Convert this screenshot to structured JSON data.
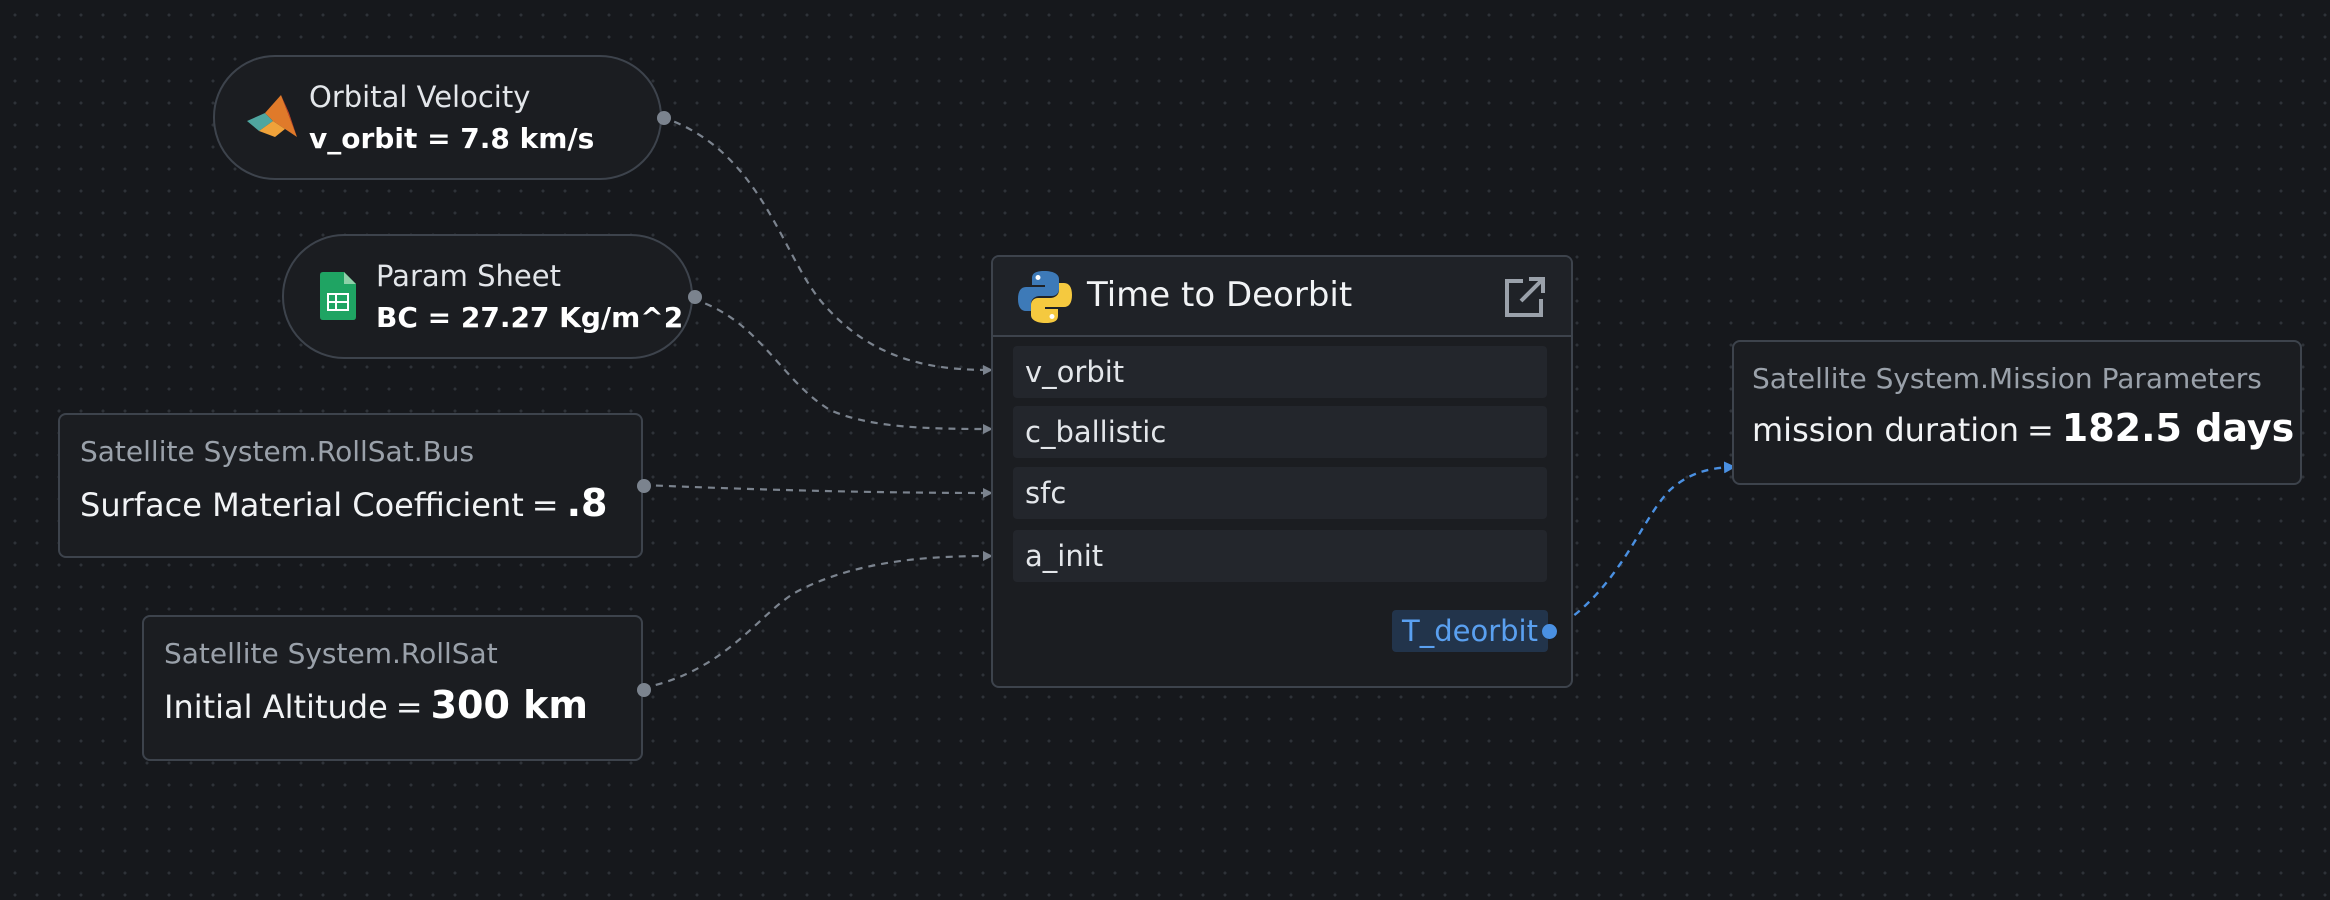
{
  "nodes": {
    "orbital_velocity": {
      "title": "Orbital Velocity",
      "value": "v_orbit = 7.8 km/s",
      "icon": "matlab-icon"
    },
    "param_sheet": {
      "title": "Param Sheet",
      "value": "BC = 27.27 Kg/m^2",
      "icon": "google-sheets-icon"
    },
    "bus_param": {
      "path": "Satellite System.RollSat.Bus",
      "name": "Surface Material Coefficient",
      "equals": "=",
      "value": ".8"
    },
    "altitude_param": {
      "path": "Satellite System.RollSat",
      "name": "Initial Altitude",
      "equals": "=",
      "value": "300 km"
    },
    "mission_param": {
      "path": "Satellite System.Mission Parameters",
      "name": "mission duration",
      "equals": "=",
      "value": "182.5 days"
    }
  },
  "function_node": {
    "title": "Time to Deorbit",
    "icon": "python-icon",
    "action_icon": "external-link-icon",
    "inputs": [
      "v_orbit",
      "c_ballistic",
      "sfc",
      "a_init"
    ],
    "output": "T_deorbit"
  },
  "colors": {
    "background": "#16181c",
    "node_border": "#3d434c",
    "wire": "#7b838e",
    "output_wire": "#4a90e2"
  }
}
